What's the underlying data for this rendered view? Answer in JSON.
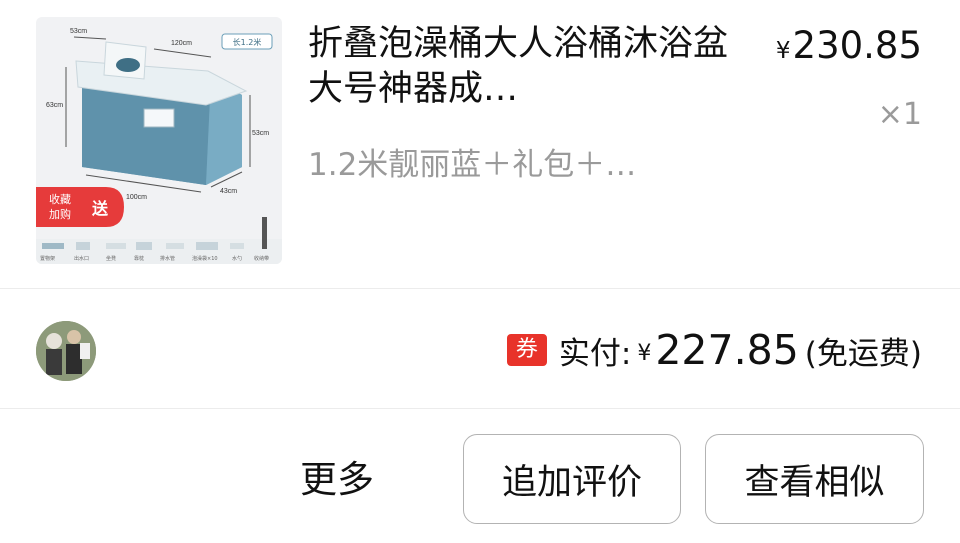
{
  "order_item": {
    "title": "折叠泡澡桶大人浴桶沐浴盆大号神器成…",
    "spec": "1.2米靓丽蓝＋礼包＋…",
    "price_currency": "¥",
    "price": "230.85",
    "quantity": "×1",
    "thumbnail": {
      "size_tag": "长1.2米",
      "dimensions": [
        "53cm",
        "120cm",
        "63cm",
        "53cm",
        "100cm",
        "43cm"
      ],
      "promo_label_line1": "收藏",
      "promo_label_line2": "加购",
      "promo_gift": "送",
      "accessory_labels": [
        "置物架",
        "出水口",
        "坐凳",
        "靠枕",
        "排水管",
        "泡澡袋×10",
        "水勺",
        "收纳带"
      ],
      "colors": {
        "tub": "#6b9fb8",
        "lid": "#e9f0f3",
        "promo": "#e63b3b"
      }
    }
  },
  "payment": {
    "coupon_icon": "券",
    "label": "实付:",
    "currency": "¥",
    "amount": "227.85",
    "shipping_note": "(免运费)",
    "coupon_color": "#e8332a"
  },
  "actions": {
    "more": "更多",
    "add_review": "追加评价",
    "view_similar": "查看相似"
  }
}
